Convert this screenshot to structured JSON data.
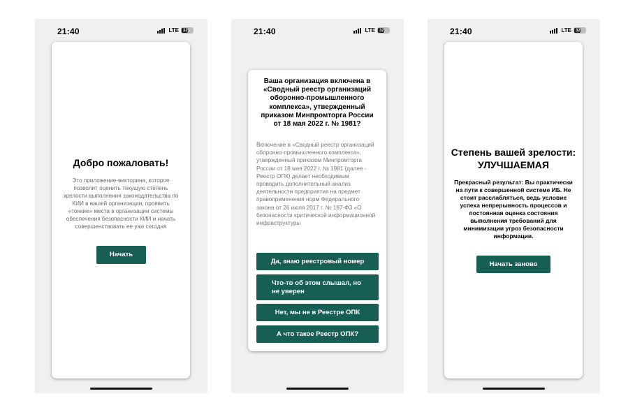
{
  "status_bar": {
    "time": "21:40",
    "network": "LTE",
    "battery": "32"
  },
  "screen_welcome": {
    "title": "Добро пожаловать!",
    "description": "Это приложение-викторина, которое позволит оценить текущую степень зрелости выполнения законодательства по КИИ в вашей организации, проявить «тонкие» места в организации системы обеспечения безопасности КИИ и начать совершенствовать ее уже сегодня",
    "start_button": "Начать"
  },
  "screen_question": {
    "title": "Ваша организация включена в «Сводный реестр организаций оборонно-промышленного комплекса», утвержденный приказом Минпромторга России от 18 мая 2022 г. № 1981?",
    "description": "Включение в «Сводный реестр организаций оборонно-промышленного комплекса», утвержденный приказом Минпромторга России от 18 мая 2022 г. № 1981 (далее - Реестр ОПК) делает необходимым проводить дополнительный анализ деятельности предприятия на предмет правоприменения норм Федерального закона от 26 июля 2017 г. № 187-ФЗ «О безопасности критической информационной инфраструктуры",
    "answers": [
      "Да, знаю реестровый номер",
      "Что-то об этом слышал, но не уверен",
      "Нет, мы не в Реестре ОПК",
      "А что такое Реестр ОПК?"
    ]
  },
  "screen_result": {
    "title": "Степень вашей зрелости:",
    "level": "УЛУЧШАЕМАЯ",
    "description": "Прекрасный результат: Вы практически на пути к совершенной системе ИБ. Не стоит расслабляться, ведь условие успеха непрерывность процессов и постоянная оценка состояния выполнения требований для минимизации угроз безопасности информации.",
    "restart_button": "Начать заново"
  },
  "colors": {
    "accent": "#175e55",
    "phone_bg": "#f0f0f0",
    "card_bg": "#ffffff"
  }
}
